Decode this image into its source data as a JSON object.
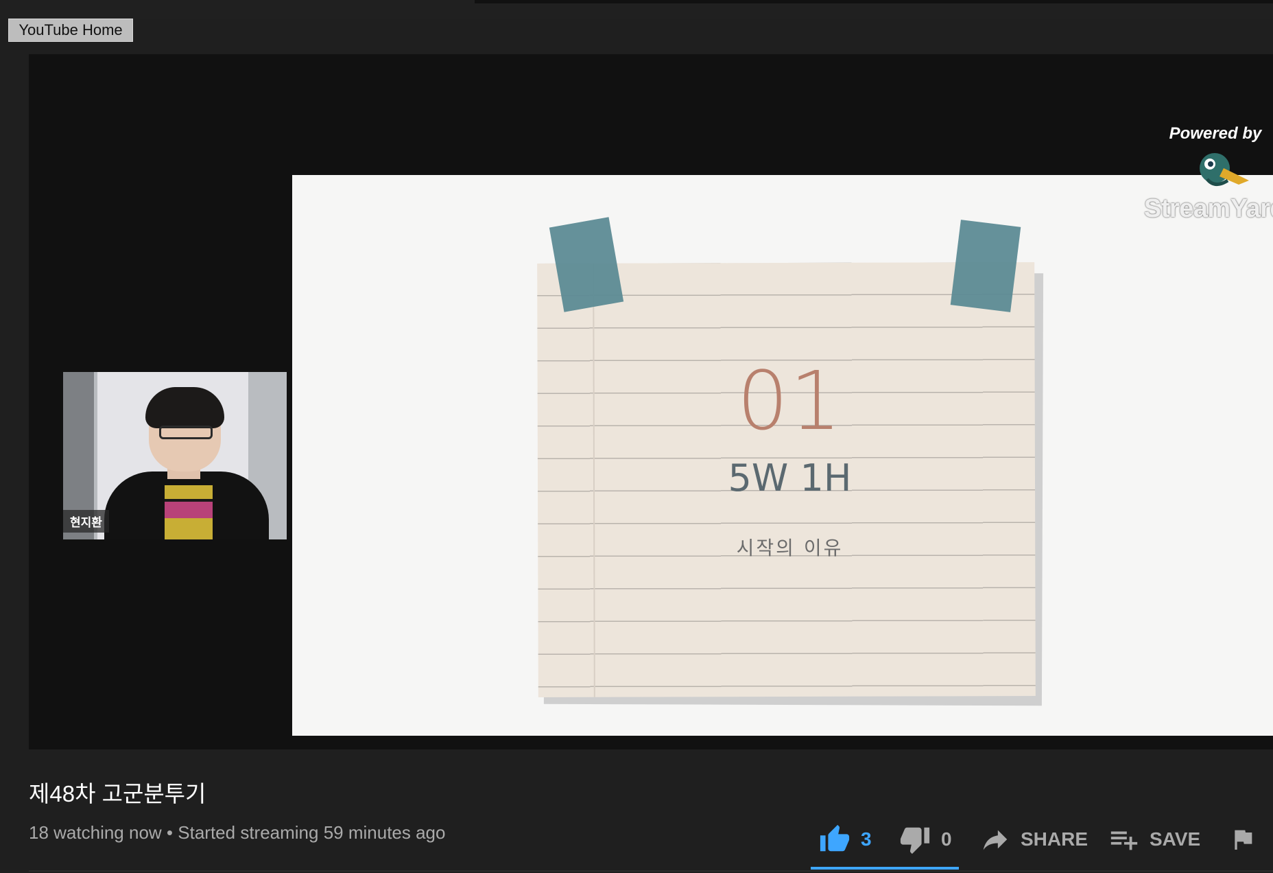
{
  "header": {
    "home_button_label": "YouTube Home"
  },
  "player": {
    "watermark": {
      "powered_by": "Powered by",
      "brand": "StreamYard"
    },
    "slide": {
      "number": "01",
      "heading": "5W 1H",
      "subheading": "시작의 이유"
    },
    "webcam": {
      "name_tag": "현지환"
    }
  },
  "video": {
    "title": "제48차 고군분투기",
    "watching": "18 watching now",
    "separator": "•",
    "started": "Started streaming 59 minutes ago"
  },
  "actions": {
    "like_count": "3",
    "dislike_count": "0",
    "share_label": "SHARE",
    "save_label": "SAVE",
    "like_ratio": 1.0
  },
  "colors": {
    "accent": "#3ea6ff",
    "background": "#1f1f1f",
    "player_background": "#111111"
  },
  "icons": [
    "thumbs-up-icon",
    "thumbs-down-icon",
    "share-arrow-icon",
    "playlist-add-icon",
    "flag-icon",
    "streamyard-duck-icon"
  ]
}
